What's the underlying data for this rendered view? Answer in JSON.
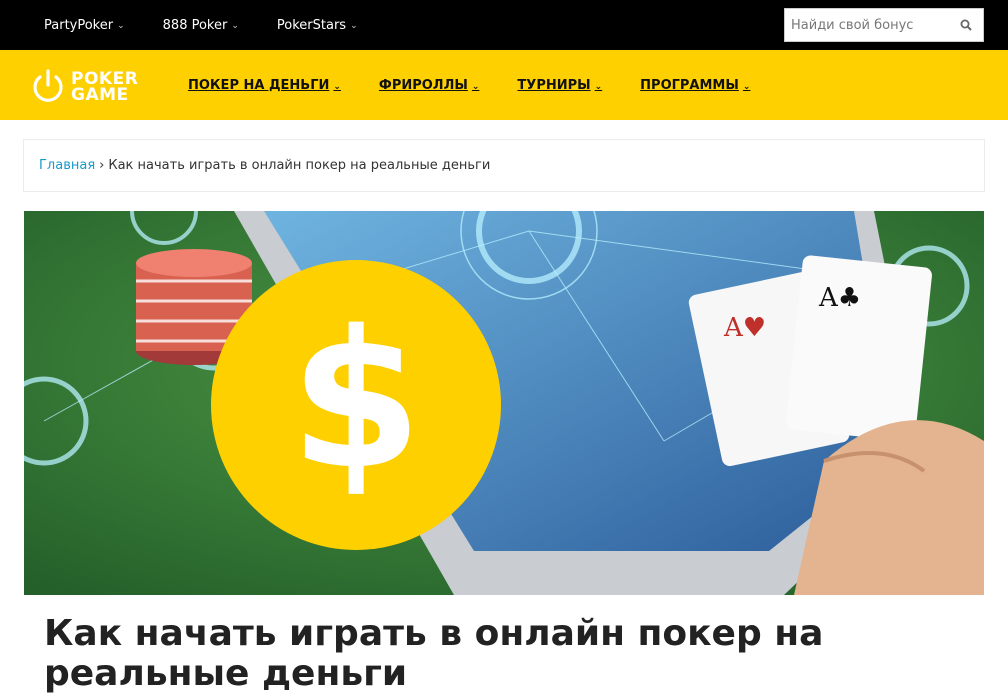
{
  "topbar": {
    "items": [
      {
        "label": "PartyPoker"
      },
      {
        "label": "888 Poker"
      },
      {
        "label": "PokerStars"
      }
    ],
    "search_placeholder": "Найди свой бонус"
  },
  "header": {
    "logo_line1": "POKER",
    "logo_line2": "GAME",
    "nav": [
      {
        "label": "ПОКЕР НА ДЕНЬГИ"
      },
      {
        "label": "ФРИРОЛЛЫ"
      },
      {
        "label": "ТУРНИРЫ"
      },
      {
        "label": "ПРОГРАММЫ"
      }
    ]
  },
  "breadcrumb": {
    "home": "Главная",
    "separator": "›",
    "current": "Как начать играть в онлайн покер на реальные деньги"
  },
  "hero": {
    "symbol": "$"
  },
  "article": {
    "title": "Как начать играть в онлайн покер на реальные деньги"
  },
  "colors": {
    "topbar": "#000000",
    "header": "#ffd000",
    "link": "#1a9ac8"
  }
}
